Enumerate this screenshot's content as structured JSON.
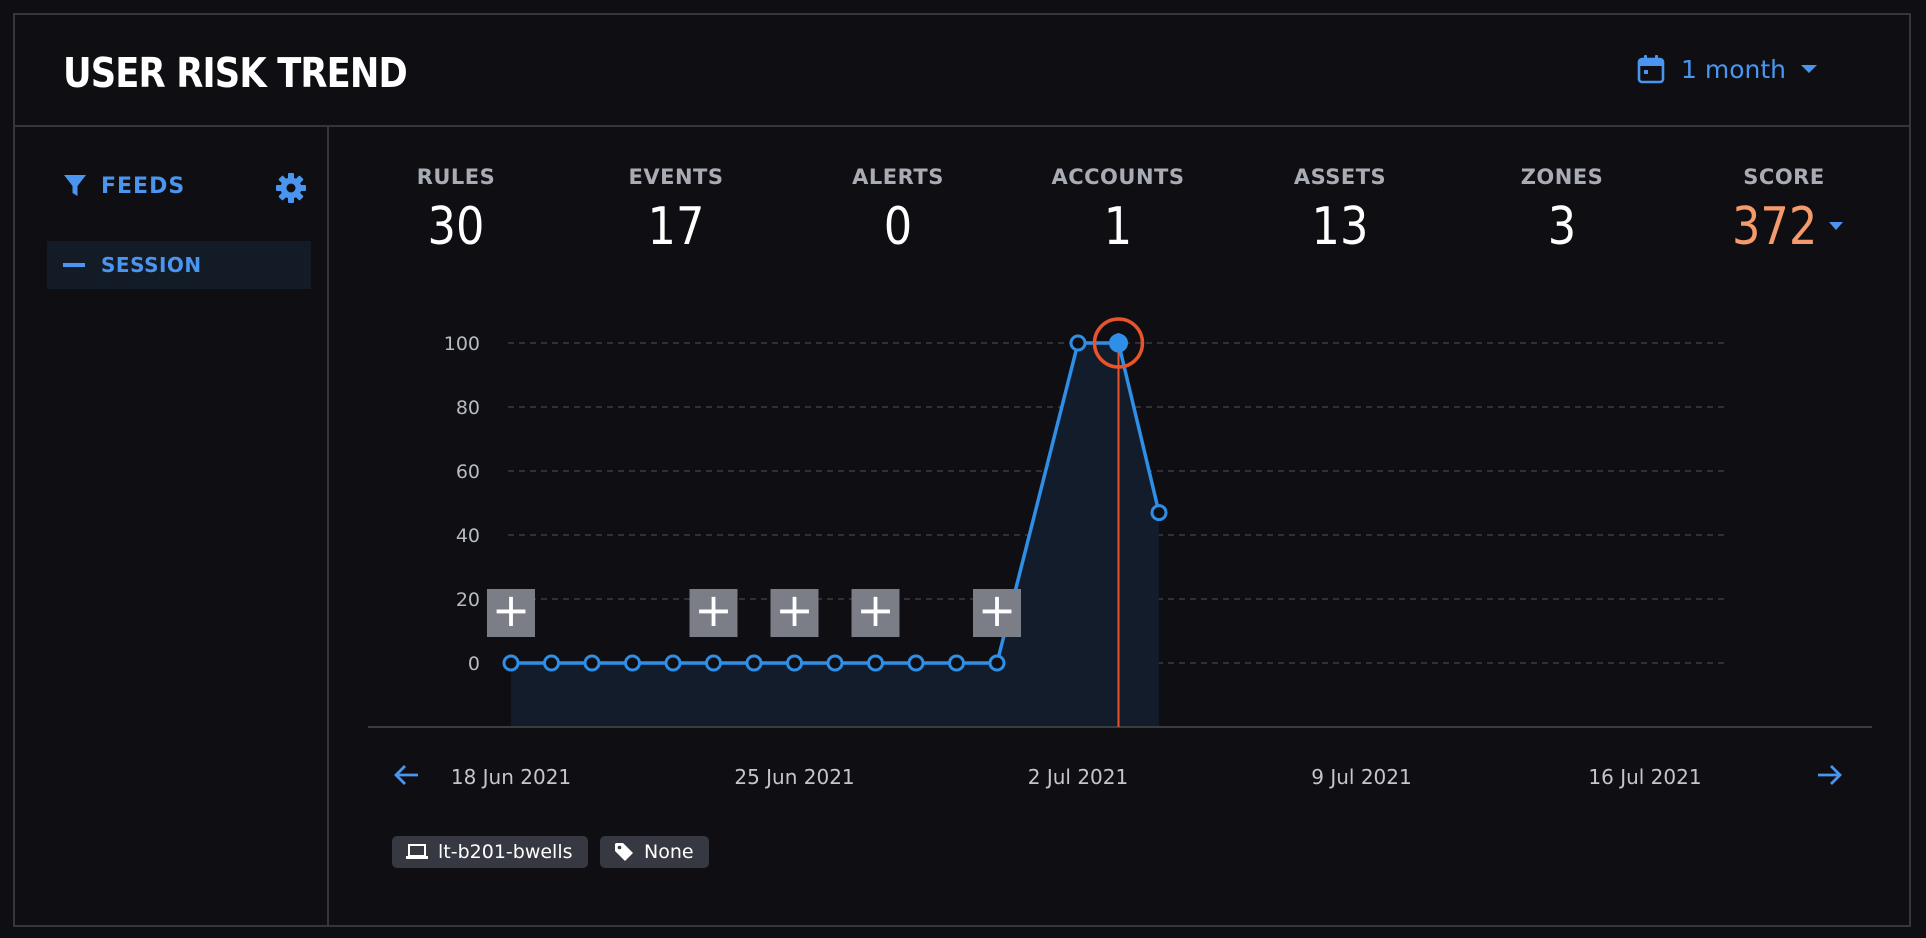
{
  "header": {
    "title": "USER RISK TREND",
    "range_label": "1 month"
  },
  "sidebar": {
    "feeds_label": "FEEDS",
    "session_label": "SESSION"
  },
  "stats": [
    {
      "label": "RULES",
      "value": "30"
    },
    {
      "label": "EVENTS",
      "value": "17"
    },
    {
      "label": "ALERTS",
      "value": "0"
    },
    {
      "label": "ACCOUNTS",
      "value": "1"
    },
    {
      "label": "ASSETS",
      "value": "13"
    },
    {
      "label": "ZONES",
      "value": "3"
    },
    {
      "label": "SCORE",
      "value": "372"
    }
  ],
  "chart_data": {
    "type": "line",
    "x": [
      "2021-06-18",
      "2021-06-19",
      "2021-06-20",
      "2021-06-21",
      "2021-06-22",
      "2021-06-23",
      "2021-06-24",
      "2021-06-25",
      "2021-06-26",
      "2021-06-27",
      "2021-06-28",
      "2021-06-29",
      "2021-06-30",
      "2021-07-01",
      "2021-07-02",
      "2021-07-03",
      "2021-07-04"
    ],
    "values": [
      0,
      0,
      0,
      0,
      0,
      0,
      0,
      0,
      0,
      0,
      0,
      0,
      0,
      null,
      100,
      100,
      47
    ],
    "selected": "2021-07-03",
    "markers": [
      "2021-06-18",
      "2021-06-23",
      "2021-06-25",
      "2021-06-27",
      "2021-06-30"
    ],
    "marker_symbol": "+",
    "y_ticks": [
      0,
      20,
      40,
      60,
      80,
      100
    ],
    "x_ticks": [
      {
        "date": "2021-06-18",
        "label": "18 Jun 2021"
      },
      {
        "date": "2021-06-25",
        "label": "25 Jun 2021"
      },
      {
        "date": "2021-07-02",
        "label": "2 Jul 2021"
      },
      {
        "date": "2021-07-09",
        "label": "9 Jul 2021"
      },
      {
        "date": "2021-07-16",
        "label": "16 Jul 2021"
      }
    ],
    "grid": true,
    "colors": {
      "line": "#2f8fe6",
      "area": "#131c2a",
      "selected": "#e8552b",
      "marker_bg": "#7b7e86"
    }
  },
  "tags": [
    {
      "icon": "laptop-icon",
      "label": "lt-b201-bwells"
    },
    {
      "icon": "tag-icon",
      "label": "None"
    }
  ],
  "colors": {
    "accent": "#4a95ef",
    "score": "#f59a6b"
  }
}
